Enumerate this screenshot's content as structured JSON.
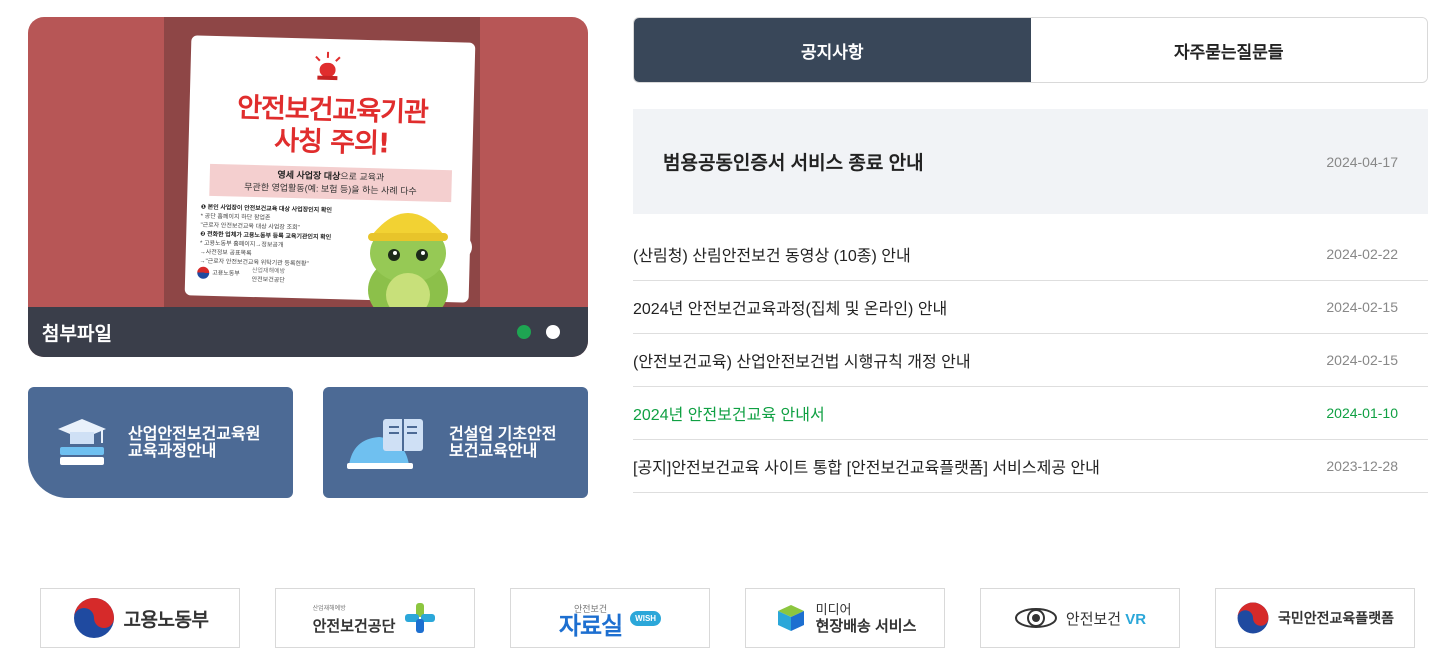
{
  "banner": {
    "poster": {
      "title_line1": "안전보건교육기관",
      "title_line2": "사칭 주의!",
      "band_bold": "영세 사업장 대상",
      "band_rest": "으로 교육과",
      "band_line2": "무관한 영업활동(예: 보험 등)을 하는 사례 다수",
      "step1": "❶ 본인 사업장이 안전보건교육 대상 사업장인지 확인",
      "step1_detail1": "* 공단 홈페이지 하단 참업존",
      "step1_detail2": "\"근로자 안전보건교육 대상 사업장 조회\"",
      "step2": "❷ 전화한 업체가 고용노동부 등록 교육기관인지 확인",
      "step2_detail1": "* 고용노동부 홈페이지→정보공개",
      "step2_detail2": "→사전정보 공표목록",
      "step2_detail3": "→\"근로자 안전보건교육 위탁기관 등록현황\"",
      "logo1": "고용노동부",
      "logo2_small": "산업재해예방",
      "logo2": "안전보건공단"
    },
    "caption": "첨부파일",
    "slide_count": 2,
    "active_slide": 1,
    "colors": {
      "active_dot": "#1ea552",
      "inactive_dot": "#ffffff"
    }
  },
  "quick_links": [
    {
      "line1": "산업안전보건교육원",
      "line2": "교육과정안내",
      "icon": "graduation-books-icon"
    },
    {
      "line1": "건설업 기초안전",
      "line2": "보건교육안내",
      "icon": "helmet-book-icon"
    }
  ],
  "board": {
    "tabs": [
      {
        "label": "공지사항",
        "active": true
      },
      {
        "label": "자주묻는질문들",
        "active": false
      }
    ],
    "featured": {
      "title": "범용공동인증서 서비스 종료 안내",
      "date": "2024-04-17"
    },
    "items": [
      {
        "title": "(산림청) 산림안전보건 동영상 (10종) 안내",
        "date": "2024-02-22"
      },
      {
        "title": "2024년 안전보건교육과정(집체 및 온라인) 안내",
        "date": "2024-02-15"
      },
      {
        "title": "(안전보건교육) 산업안전보건법 시행규칙 개정 안내",
        "date": "2024-02-15"
      },
      {
        "title": "2024년 안전보건교육 안내서",
        "date": "2024-01-10",
        "highlight": true
      },
      {
        "title": "[공지]안전보건교육 사이트 통합 [안전보건교육플랫폼] 서비스제공 안내",
        "date": "2023-12-28"
      }
    ],
    "colors": {
      "tab_active": "#394759",
      "highlight": "#10a043"
    }
  },
  "partners": [
    {
      "name": "고용노동부"
    },
    {
      "small": "산업재해예방",
      "name": "안전보건공단"
    },
    {
      "small": "안전보건",
      "name": "자료실",
      "badge": "WISH"
    },
    {
      "line1": "미디어",
      "line2": "현장배송 서비스"
    },
    {
      "name": "안전보건",
      "accent": "VR"
    },
    {
      "name": "국민안전교육플랫폼"
    }
  ]
}
